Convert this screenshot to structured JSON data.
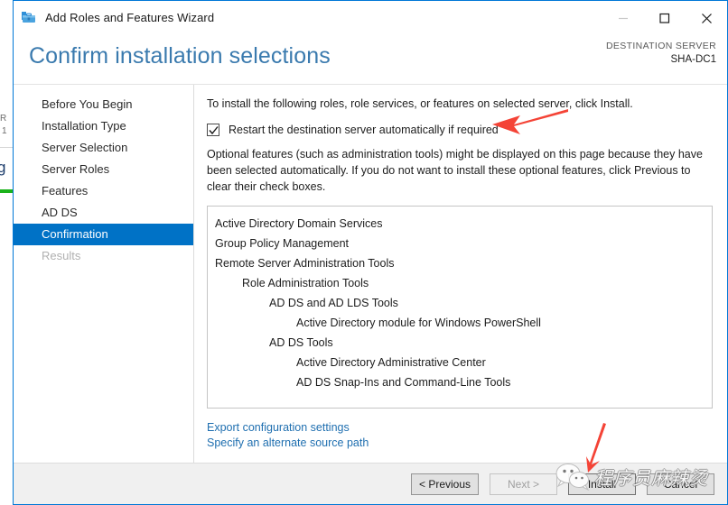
{
  "window": {
    "title": "Add Roles and Features Wizard",
    "icon": "toolbox-icon",
    "minimize_label": "Minimize",
    "maximize_label": "Maximize",
    "close_label": "Close",
    "accent_color": "#0078d7"
  },
  "header": {
    "page_title": "Confirm installation selections",
    "destination_label": "DESTINATION SERVER",
    "destination_value": "SHA-DC1",
    "title_color": "#3a7aae"
  },
  "sidebar": {
    "items": [
      {
        "label": "Before You Begin",
        "state": "normal"
      },
      {
        "label": "Installation Type",
        "state": "normal"
      },
      {
        "label": "Server Selection",
        "state": "normal"
      },
      {
        "label": "Server Roles",
        "state": "normal"
      },
      {
        "label": "Features",
        "state": "normal"
      },
      {
        "label": "AD DS",
        "state": "normal"
      },
      {
        "label": "Confirmation",
        "state": "active"
      },
      {
        "label": "Results",
        "state": "disabled"
      }
    ],
    "active_background": "#0072c6",
    "active_color": "#ffffff",
    "disabled_color": "#b0b0b0"
  },
  "content": {
    "intro": "To install the following roles, role services, or features on selected server, click Install.",
    "restart_checkbox": {
      "label": "Restart the destination server automatically if required",
      "checked": true
    },
    "optional_note": "Optional features (such as administration tools) might be displayed on this page because they have been selected automatically. If you do not want to install these optional features, click Previous to clear their check boxes.",
    "features": [
      {
        "label": "Active Directory Domain Services",
        "level": 0
      },
      {
        "label": "Group Policy Management",
        "level": 0
      },
      {
        "label": "Remote Server Administration Tools",
        "level": 0
      },
      {
        "label": "Role Administration Tools",
        "level": 1
      },
      {
        "label": "AD DS and AD LDS Tools",
        "level": 2
      },
      {
        "label": "Active Directory module for Windows PowerShell",
        "level": 3
      },
      {
        "label": "AD DS Tools",
        "level": 2
      },
      {
        "label": "Active Directory Administrative Center",
        "level": 3
      },
      {
        "label": "AD DS Snap-Ins and Command-Line Tools",
        "level": 3
      }
    ],
    "links": [
      {
        "label": "Export configuration settings"
      },
      {
        "label": "Specify an alternate source path"
      }
    ],
    "link_color": "#1f6fb0"
  },
  "footer": {
    "buttons": [
      {
        "label": "< Previous",
        "state": "normal"
      },
      {
        "label": "Next >",
        "state": "disabled"
      },
      {
        "label": "Install",
        "state": "default"
      },
      {
        "label": "Cancel",
        "state": "normal"
      }
    ]
  },
  "annotations": {
    "arrow_color": "#f44336",
    "arrow_restart_target": "Restart the destination server automatically if required",
    "arrow_install_target": "Install"
  },
  "watermark": {
    "text": "程序员麻辣烫",
    "icon": "wechat-icon"
  },
  "background_window": {
    "fragment_1": "R",
    "fragment_2": "1",
    "fragment_3": "g"
  }
}
